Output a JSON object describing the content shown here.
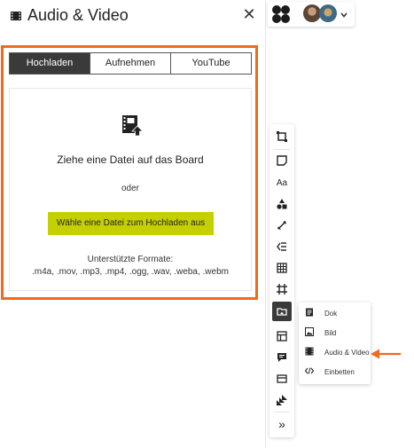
{
  "panel": {
    "title": "Audio & Video",
    "close_icon": "close-icon",
    "tabs": [
      "Hochladen",
      "Aufnehmen",
      "YouTube"
    ],
    "active_tab": "Hochladen",
    "drop_title": "Ziehe eine Datei auf das Board",
    "or_text": "oder",
    "choose_button": "Wähle eine Datei zum Hochladen aus",
    "formats_label": "Unterstützte Formate:",
    "formats_list": ".m4a, .mov, .mp3, .mp4, .ogg, .wav, .weba, .webm"
  },
  "toolbar": {
    "tools": [
      {
        "name": "frame-icon"
      },
      {
        "name": "sticky-note-icon"
      },
      {
        "name": "text-icon",
        "label": "Aa"
      },
      {
        "name": "shapes-icon"
      },
      {
        "name": "connector-icon"
      },
      {
        "name": "mindmap-icon"
      },
      {
        "name": "table-icon"
      },
      {
        "name": "crop-frame-icon"
      },
      {
        "name": "media-icon",
        "active": true
      },
      {
        "name": "template-icon"
      },
      {
        "name": "comment-icon"
      },
      {
        "name": "card-icon"
      },
      {
        "name": "jira-icon"
      },
      {
        "name": "more-icon",
        "label": "»"
      }
    ]
  },
  "submenu": {
    "items": [
      {
        "label": "Dok",
        "icon": "document-icon"
      },
      {
        "label": "Bild",
        "icon": "image-icon"
      },
      {
        "label": "Audio & Video",
        "icon": "film-icon"
      },
      {
        "label": "Einbetten",
        "icon": "embed-code-icon"
      }
    ]
  },
  "colors": {
    "highlight": "#f06a1d",
    "primary_button": "#c5d000",
    "active_tab": "#3a3a3a"
  }
}
